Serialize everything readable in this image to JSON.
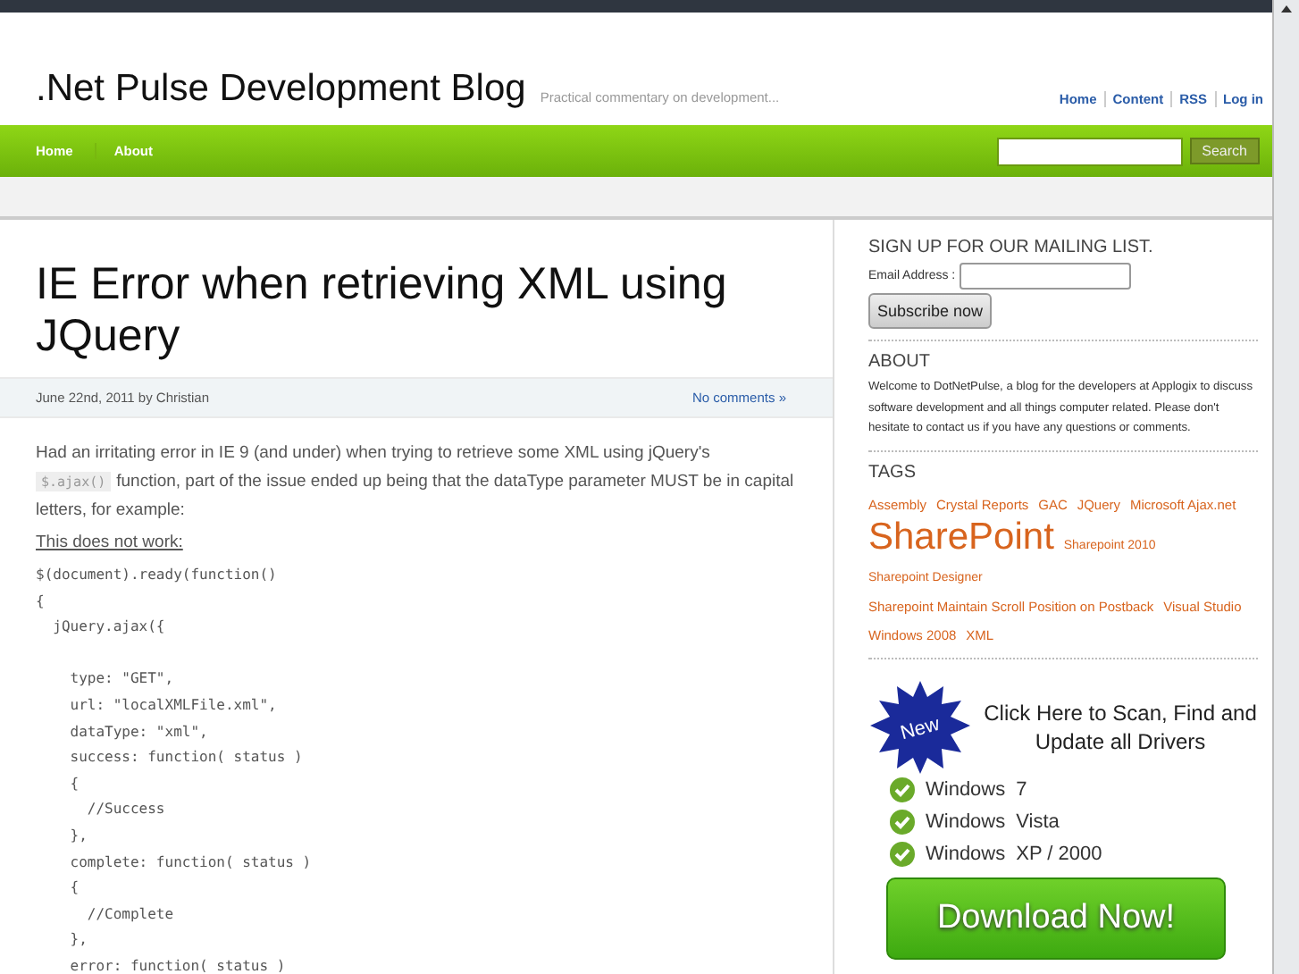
{
  "header": {
    "title": ".Net Pulse Development Blog",
    "tagline": "Practical commentary on development...",
    "links": [
      "Home",
      "Content",
      "RSS",
      "Log in"
    ]
  },
  "nav": {
    "items": [
      "Home",
      "About"
    ],
    "search_button": "Search"
  },
  "post": {
    "title": "IE Error when retrieving XML using JQuery",
    "meta": "June 22nd, 2011 by Christian",
    "comments_link": "No comments »",
    "intro_before": "Had an irritating error in IE 9 (and under) when trying to retrieve some XML using jQuery's",
    "intro_code": "$.ajax()",
    "intro_after": "function, part of the issue ended up being that the dataType parameter MUST be in capital letters, for example:",
    "note": "This does not work:",
    "code_lines": [
      {
        "text": "$(document).ready(function()"
      },
      {
        "text": "{"
      },
      {
        "text": "  jQuery.ajax({"
      },
      {
        "text": "    type: \"GET\",",
        "gap_before": true
      },
      {
        "text": "    url: \"localXMLFile.xml\","
      },
      {
        "text": "    dataType: \"xml\","
      },
      {
        "text": "    success: function( status )"
      },
      {
        "text": "    {"
      },
      {
        "text": "      //Success"
      },
      {
        "text": "    },"
      },
      {
        "text": "    complete: function( status )"
      },
      {
        "text": "    {"
      },
      {
        "text": "      //Complete"
      },
      {
        "text": "    },"
      },
      {
        "text": "    error: function( status )"
      }
    ]
  },
  "sidebar": {
    "mailing": {
      "heading": "SIGN UP FOR OUR MAILING LIST.",
      "email_label": "Email Address :",
      "button": "Subscribe now"
    },
    "about": {
      "heading": "ABOUT",
      "text": "Welcome to DotNetPulse, a blog for the developers at Applogix to discuss software development and all things computer related. Please don't hesitate to contact us if you have any questions or comments."
    },
    "tags": {
      "heading": "TAGS",
      "items": [
        {
          "label": "Assembly",
          "kind": "normal"
        },
        {
          "label": "Crystal Reports",
          "kind": "normal"
        },
        {
          "label": "GAC",
          "kind": "normal"
        },
        {
          "label": "JQuery",
          "kind": "normal"
        },
        {
          "label": "Microsoft Ajax.net",
          "kind": "normal"
        },
        {
          "label": "SharePoint",
          "kind": "large"
        },
        {
          "label": "Sharepoint 2010",
          "kind": "small"
        },
        {
          "label": "Sharepoint Designer",
          "kind": "small"
        },
        {
          "label": "Sharepoint Maintain Scroll Position on Postback",
          "kind": "normal"
        },
        {
          "label": "Visual Studio",
          "kind": "normal"
        },
        {
          "label": "Windows 2008",
          "kind": "normal"
        },
        {
          "label": "XML",
          "kind": "normal"
        }
      ]
    },
    "ad": {
      "badge": "New",
      "headline": "Click Here to Scan, Find and Update all Drivers",
      "items": [
        {
          "os": "Windows",
          "version": "7"
        },
        {
          "os": "Windows",
          "version": "Vista"
        },
        {
          "os": "Windows",
          "version": "XP / 2000"
        }
      ],
      "button": "Download Now!"
    }
  }
}
